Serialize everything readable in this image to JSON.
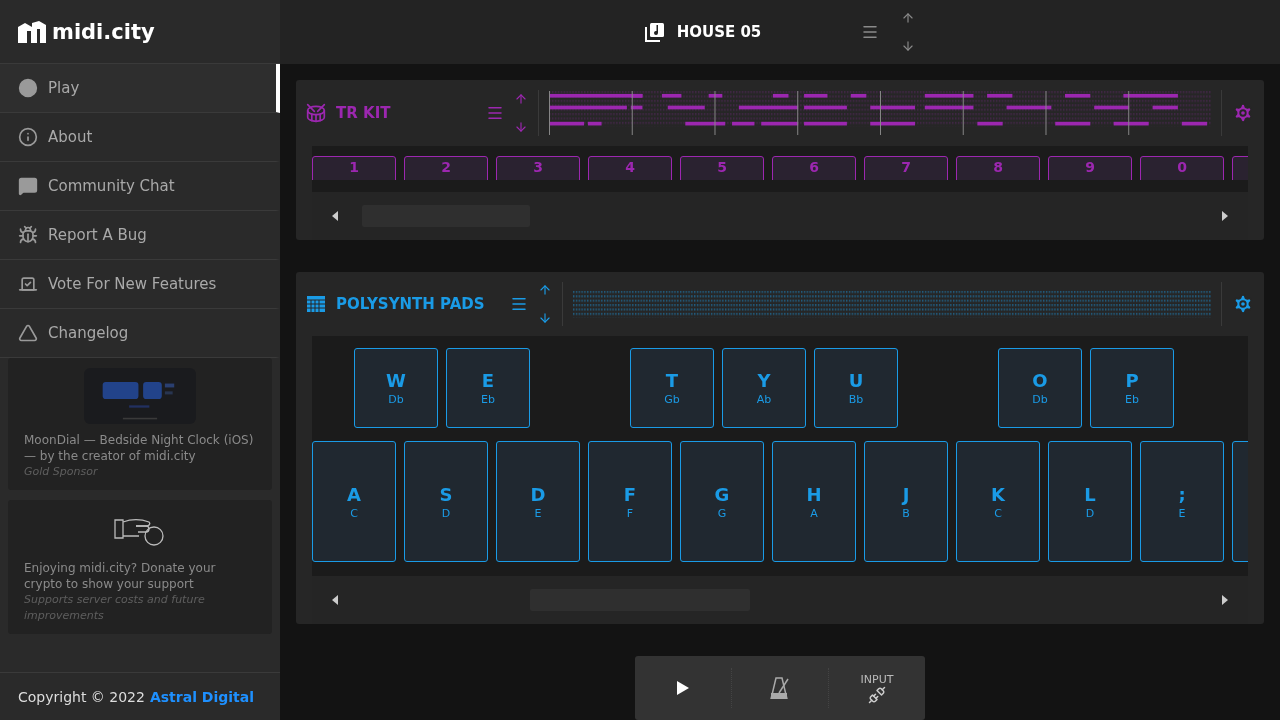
{
  "logo": {
    "text": "midi.city"
  },
  "menu": [
    {
      "label": "Play",
      "kind": "play",
      "selected": true
    },
    {
      "label": "About",
      "kind": "about",
      "selected": false
    },
    {
      "label": "Community Chat",
      "kind": "chat",
      "selected": false
    },
    {
      "label": "Report A Bug",
      "kind": "bug",
      "selected": false
    },
    {
      "label": "Vote For New Features",
      "kind": "vote",
      "selected": false
    },
    {
      "label": "Changelog",
      "kind": "changelog",
      "selected": false
    }
  ],
  "sponsor": {
    "kind": "picture",
    "title": "MoonDial — Bedside Night Clock (iOS) — by the creator of midi.city",
    "tier": "Gold Sponsor"
  },
  "donate": {
    "text": "Enjoying midi.city? Donate your crypto to show your support",
    "note": "Supports server costs and future improvements"
  },
  "footer": {
    "copyright": "Copyright © 2022",
    "company": "Astral Digital"
  },
  "project": {
    "title": "HOUSE 05"
  },
  "instruments": [
    {
      "name": "TR KIT",
      "kind": "drums",
      "color": "#9c27b0",
      "pads": [
        "1",
        "2",
        "3",
        "4",
        "5",
        "6",
        "7",
        "8",
        "9",
        "0"
      ]
    },
    {
      "name": "POLYSYNTH PADS",
      "kind": "synth",
      "color": "#1a9be6",
      "upper": [
        {
          "kind": "key",
          "key": "W",
          "note": "Db"
        },
        {
          "kind": "key",
          "key": "E",
          "note": "Eb"
        },
        {
          "kind": "gap"
        },
        {
          "kind": "key",
          "key": "T",
          "note": "Gb"
        },
        {
          "kind": "key",
          "key": "Y",
          "note": "Ab"
        },
        {
          "kind": "key",
          "key": "U",
          "note": "Bb"
        },
        {
          "kind": "gap"
        },
        {
          "kind": "key",
          "key": "O",
          "note": "Db"
        },
        {
          "kind": "key",
          "key": "P",
          "note": "Eb"
        }
      ],
      "lower": [
        {
          "key": "A",
          "note": "C"
        },
        {
          "key": "S",
          "note": "D"
        },
        {
          "key": "D",
          "note": "E"
        },
        {
          "key": "F",
          "note": "F"
        },
        {
          "key": "G",
          "note": "G"
        },
        {
          "key": "H",
          "note": "A"
        },
        {
          "key": "J",
          "note": "B"
        },
        {
          "key": "K",
          "note": "C"
        },
        {
          "key": "L",
          "note": "D"
        },
        {
          "key": ";",
          "note": "E"
        }
      ]
    }
  ],
  "transport": {
    "input_label": "INPUT"
  }
}
